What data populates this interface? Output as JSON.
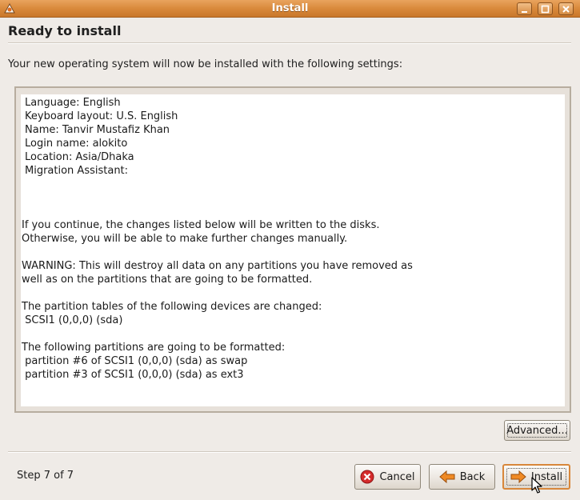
{
  "window": {
    "title": "Install"
  },
  "page": {
    "heading": "Ready to install",
    "intro": "Your new operating system will now be installed with the following settings:"
  },
  "summary": {
    "lines": [
      "Language: English",
      "Keyboard layout: U.S. English",
      "Name: Tanvir Mustafiz Khan",
      "Login name: alokito",
      "Location: Asia/Dhaka",
      "Migration Assistant:",
      "If you continue, the changes listed below will be written to the disks.",
      "Otherwise, you will be able to make further changes manually.",
      "WARNING: This will destroy all data on any partitions you have removed as",
      "well as on the partitions that are going to be formatted.",
      "The partition tables of the following devices are changed:",
      " SCSI1 (0,0,0) (sda)",
      "The following partitions are going to be formatted:",
      " partition #6 of SCSI1 (0,0,0) (sda) as swap",
      " partition #3 of SCSI1 (0,0,0) (sda) as ext3"
    ]
  },
  "buttons": {
    "advanced": "Advanced...",
    "cancel": "Cancel",
    "back": "Back",
    "install": "Install"
  },
  "footer": {
    "step": "Step 7 of 7"
  },
  "icons": {
    "app": "ubuntu-installer-icon",
    "cancel": "cancel-icon",
    "back": "back-arrow-icon",
    "install": "forward-arrow-icon"
  },
  "colors": {
    "titlebar": "#d98a3c",
    "window_bg": "#efebe7",
    "cancel_icon": "#d42b2b",
    "arrow_icon": "#f08a24"
  }
}
